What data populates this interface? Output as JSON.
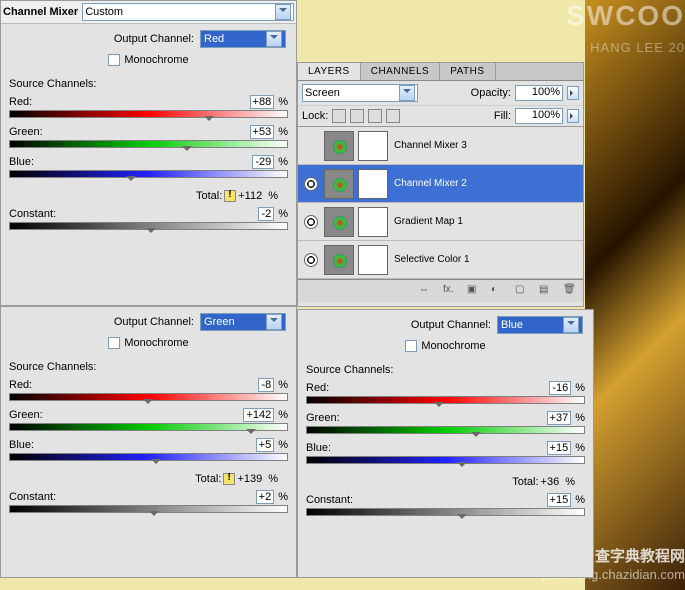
{
  "panel1": {
    "title_label": "Channel Mixer",
    "preset": "Custom",
    "output_label": "Output Channel:",
    "output_value": "Red",
    "monochrome_label": "Monochrome",
    "source_label": "Source Channels:",
    "red_label": "Red:",
    "red_value": "+88",
    "green_label": "Green:",
    "green_value": "+53",
    "blue_label": "Blue:",
    "blue_value": "-29",
    "total_label": "Total:",
    "total_value": "+112",
    "constant_label": "Constant:",
    "constant_value": "-2",
    "pct": "%"
  },
  "panel2": {
    "output_label": "Output Channel:",
    "output_value": "Green",
    "monochrome_label": "Monochrome",
    "source_label": "Source Channels:",
    "red_label": "Red:",
    "red_value": "-8",
    "green_label": "Green:",
    "green_value": "+142",
    "blue_label": "Blue:",
    "blue_value": "+5",
    "total_label": "Total:",
    "total_value": "+139",
    "constant_label": "Constant:",
    "constant_value": "+2",
    "pct": "%"
  },
  "panel3": {
    "output_label": "Output Channel:",
    "output_value": "Blue",
    "monochrome_label": "Monochrome",
    "source_label": "Source Channels:",
    "red_label": "Red:",
    "red_value": "-16",
    "green_label": "Green:",
    "green_value": "+37",
    "blue_label": "Blue:",
    "blue_value": "+15",
    "total_label": "Total:",
    "total_value": "+36",
    "constant_label": "Constant:",
    "constant_value": "+15",
    "pct": "%"
  },
  "layers": {
    "tabs": [
      "LAYERS",
      "CHANNELS",
      "PATHS"
    ],
    "blend_mode": "Screen",
    "opacity_label": "Opacity:",
    "opacity_value": "100%",
    "lock_label": "Lock:",
    "fill_label": "Fill:",
    "fill_value": "100%",
    "items": [
      {
        "name": "Channel Mixer 3",
        "eye": false,
        "sel": false
      },
      {
        "name": "Channel Mixer 2",
        "eye": true,
        "sel": true
      },
      {
        "name": "Gradient Map 1",
        "eye": true,
        "sel": false
      },
      {
        "name": "Selective Color 1",
        "eye": true,
        "sel": false
      }
    ]
  },
  "watermark": {
    "big": "SWCOO",
    "sub": "HANG LEE 20",
    "site": "查字典教程网",
    "url": "jiaocheng.chazidian.com"
  }
}
